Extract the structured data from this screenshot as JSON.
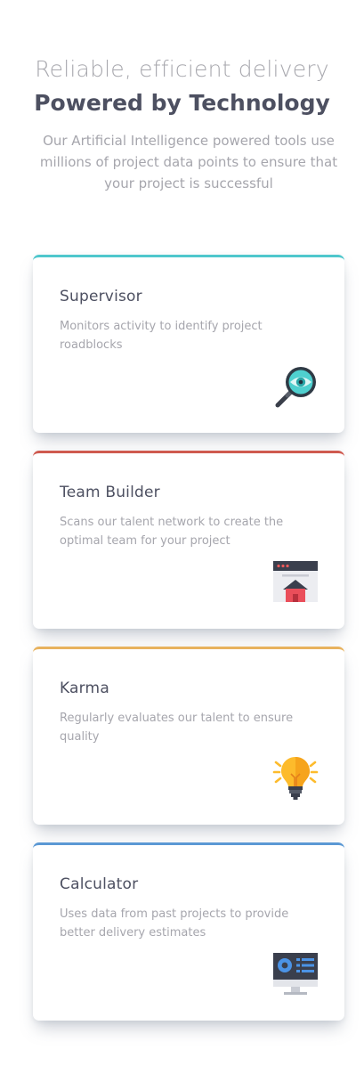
{
  "header": {
    "tagline": "Reliable, efficient delivery",
    "headline": "Powered by Technology",
    "intro": "Our Artificial Intelligence powered tools use millions of project data points to ensure that your project is successful"
  },
  "cards": [
    {
      "title": "Supervisor",
      "description": "Monitors activity to identify project roadblocks",
      "icon": "magnifier-eye-icon",
      "accent": "#44d3d2"
    },
    {
      "title": "Team Builder",
      "description": "Scans our talent network to create the optimal team for your project",
      "icon": "browser-house-icon",
      "accent": "#ea5454"
    },
    {
      "title": "Karma",
      "description": "Regularly evaluates our talent to ensure quality",
      "icon": "lightbulb-icon",
      "accent": "#fcaf41"
    },
    {
      "title": "Calculator",
      "description": "Uses data from past projects to provide better delivery estimates",
      "icon": "monitor-dashboard-icon",
      "accent": "#549ef2"
    }
  ]
}
